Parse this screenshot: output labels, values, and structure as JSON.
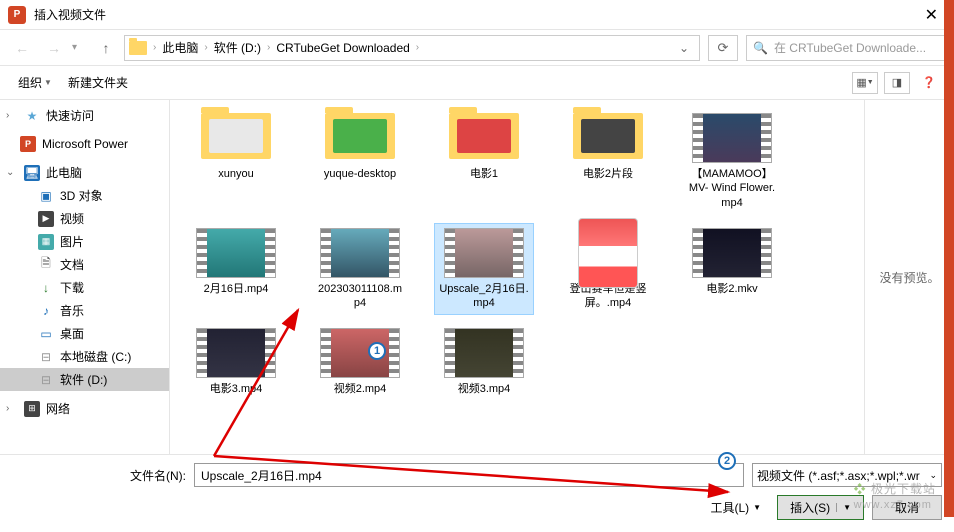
{
  "titlebar": {
    "app_badge": "P",
    "title": "插入视频文件"
  },
  "nav": {
    "crumbs": [
      "此电脑",
      "软件 (D:)",
      "CRTubeGet Downloaded"
    ],
    "search_placeholder": "在 CRTubeGet Downloade..."
  },
  "toolbar": {
    "organize": "组织",
    "new_folder": "新建文件夹"
  },
  "sidebar": {
    "quick": "快速访问",
    "powerpoint": "Microsoft Power",
    "thispc": "此电脑",
    "items": [
      "3D 对象",
      "视频",
      "图片",
      "文档",
      "下载",
      "音乐",
      "桌面",
      "本地磁盘 (C:)",
      "软件 (D:)"
    ],
    "network": "网络"
  },
  "files": [
    {
      "name": "xunyou",
      "type": "folder",
      "color": "#e8e8e8"
    },
    {
      "name": "yuque-desktop",
      "type": "folder",
      "color": "#4ab04a"
    },
    {
      "name": "电影1",
      "type": "folder",
      "color": "#d44"
    },
    {
      "name": "电影2片段",
      "type": "folder",
      "color": "#444"
    },
    {
      "name": "【MAMAMOO】MV- Wind Flower.mp4",
      "type": "video",
      "bg": "linear-gradient(#2a4a6a,#4a3a5a)"
    },
    {
      "name": "2月16日.mp4",
      "type": "video",
      "bg": "linear-gradient(#4aa,#277)"
    },
    {
      "name": "202303011108.mp4",
      "type": "video",
      "bg": "linear-gradient(#6ab,#356)"
    },
    {
      "name": "Upscale_2月16日.mp4",
      "type": "video",
      "bg": "linear-gradient(#b99,#766)",
      "selected": true
    },
    {
      "name": "登山赛车但是竖屏。.mp4",
      "type": "app"
    },
    {
      "name": "电影2.mkv",
      "type": "video",
      "bg": "linear-gradient(#112,#223)"
    },
    {
      "name": "电影3.mp4",
      "type": "video",
      "bg": "linear-gradient(#223,#334)"
    },
    {
      "name": "视频2.mp4",
      "type": "video",
      "bg": "linear-gradient(#c66,#844)"
    },
    {
      "name": "视频3.mp4",
      "type": "video",
      "bg": "linear-gradient(#332,#443)"
    }
  ],
  "preview": {
    "none": "没有预览。"
  },
  "footer": {
    "filename_label": "文件名(N):",
    "filename_value": "Upscale_2月16日.mp4",
    "filetype": "视频文件 (*.asf;*.asx;*.wpl;*.wr",
    "tools": "工具(L)",
    "insert": "插入(S)",
    "cancel": "取消"
  },
  "badges": {
    "b1": "1",
    "b2": "2"
  },
  "watermark": {
    "t1": "极光下载站",
    "t2": "www.xz7.com"
  }
}
